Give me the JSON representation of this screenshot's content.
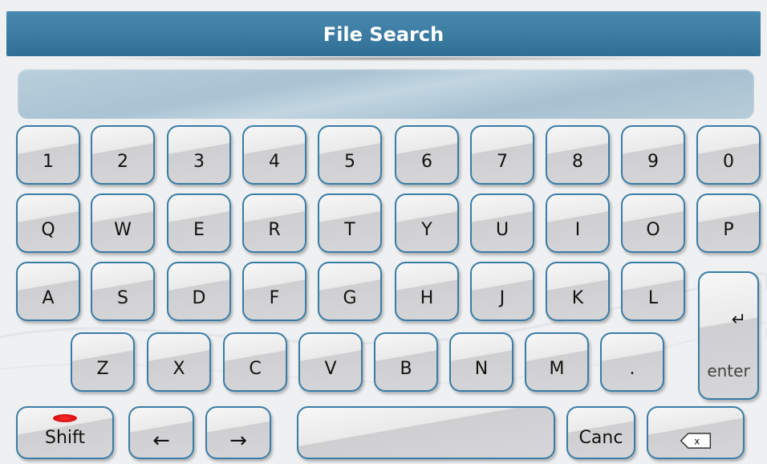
{
  "window": {
    "title": "File Search"
  },
  "search": {
    "value": ""
  },
  "keys": {
    "row1": [
      "1",
      "2",
      "3",
      "4",
      "5",
      "6",
      "7",
      "8",
      "9",
      "0"
    ],
    "row2": [
      "Q",
      "W",
      "E",
      "R",
      "T",
      "Y",
      "U",
      "I",
      "O",
      "P"
    ],
    "row3": [
      "A",
      "S",
      "D",
      "F",
      "G",
      "H",
      "J",
      "K",
      "L"
    ],
    "row4": [
      "Z",
      "X",
      "C",
      "V",
      "B",
      "N",
      "M",
      "."
    ],
    "enter": {
      "label": "enter",
      "symbol": "↵"
    },
    "shift": {
      "label": "Shift",
      "indicator_color": "#e00000"
    },
    "left_arrow": "←",
    "right_arrow": "→",
    "canc": "Canc",
    "backspace_icon": "backspace-icon"
  },
  "colors": {
    "title_bar": "#3a7ca6",
    "key_border": "#3a7ca6",
    "search_field": "#b3cad9"
  }
}
